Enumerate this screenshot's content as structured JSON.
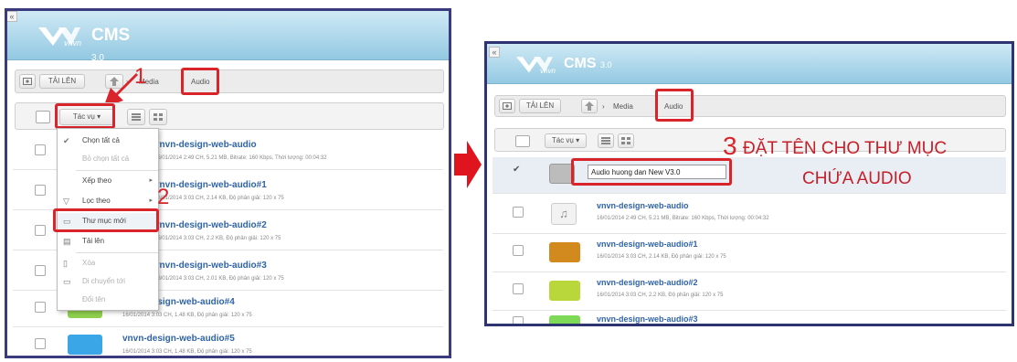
{
  "brand": {
    "vn": "vnvn",
    "cms": "CMS",
    "ver": "3.0"
  },
  "toolbar": {
    "upload": "TẢI LÊN",
    "crumb_media": "Media",
    "crumb_audio": "Audio",
    "action": "Tác vụ"
  },
  "steps": {
    "one": "1",
    "two": "2",
    "three": "3"
  },
  "menu": {
    "select_all": "Chọn tất cả",
    "deselect_all": "Bỏ chọn tất cả",
    "sort_by": "Xếp theo",
    "filter_by": "Lọc theo",
    "new_folder": "Thư mục mới",
    "upload": "Tải lên",
    "delete": "Xóa",
    "move_to": "Di chuyển tới",
    "rename": "Đổi tên"
  },
  "left_files": [
    {
      "name": "vnvn-design-web-audio",
      "meta": "16/01/2014 2:49 CH, 5.21 MB, Bitrate: 160 Kbps, Thời lượng: 00:04:32"
    },
    {
      "name": "vnvn-design-web-audio#1",
      "meta": "16/01/2014 3:03 CH, 2.14 KB, Độ phân giải: 120 x 75"
    },
    {
      "name": "vnvn-design-web-audio#2",
      "meta": "16/01/2014 3:03 CH, 2.2 KB, Độ phân giải: 120 x 75"
    },
    {
      "name": "vnvn-design-web-audio#3",
      "meta": "16/01/2014 3:03 CH, 2.01 KB, Độ phân giải: 120 x 75"
    },
    {
      "name": "vnvn-design-web-audio#4",
      "meta": "16/01/2014 3:03 CH, 1.48 KB, Độ phân giải: 120 x 75"
    },
    {
      "name": "vnvn-design-web-audio#5",
      "meta": "16/01/2014 3:03 CH, 1.48 KB, Độ phân giải: 120 x 75"
    }
  ],
  "right_files": [
    {
      "name": "vnvn-design-web-audio",
      "meta": "16/01/2014 2:49 CH, 5.21 MB, Bitrate: 160 Kbps, Thời lượng: 00:04:32"
    },
    {
      "name": "vnvn-design-web-audio#1",
      "meta": "16/01/2014 3:03 CH, 2.14 KB, Độ phân giải: 120 x 75"
    },
    {
      "name": "vnvn-design-web-audio#2",
      "meta": "16/01/2014 3:03 CH, 2.2 KB, Độ phân giải: 120 x 75"
    },
    {
      "name": "vnvn-design-web-audio#3",
      "meta": ""
    }
  ],
  "new_folder_input": "Audio huong dan New V3.0",
  "annotation": {
    "line1": "ĐẶT TÊN CHO THƯ MỤC",
    "line2": "CHỨA AUDIO"
  },
  "colors": {
    "header": "#93c9e2",
    "accent_red": "#d9242b",
    "link": "#2f64a8",
    "frame": "#3a3a7e"
  },
  "icons": {
    "upload": "image-icon",
    "home": "home-up-icon",
    "list": "list-view-icon",
    "grid": "grid-view-icon",
    "music": "music-note-icon",
    "folder": "folder-icon",
    "check": "check-icon"
  }
}
